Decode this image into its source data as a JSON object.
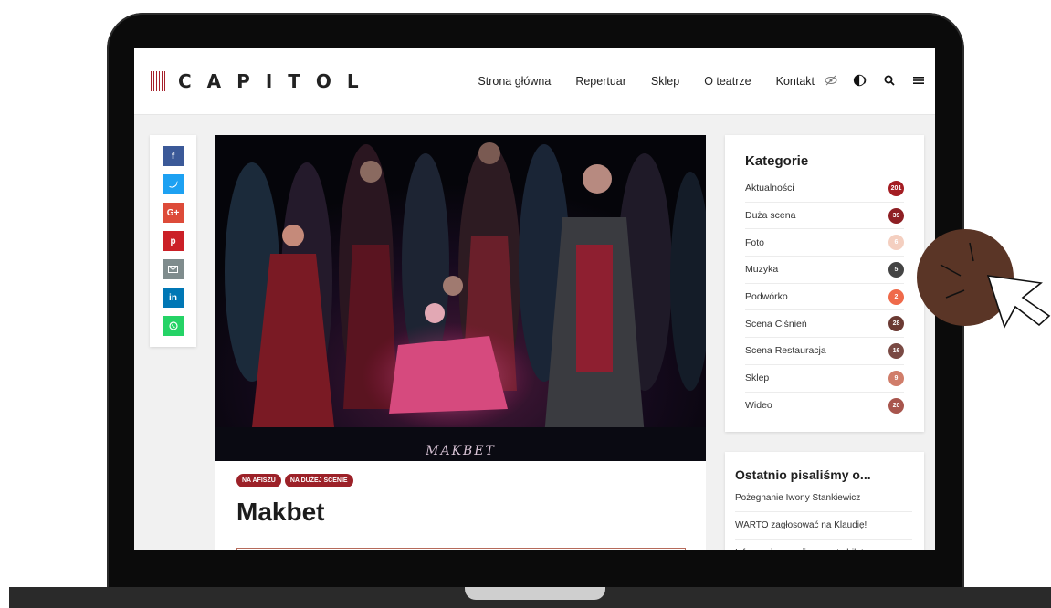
{
  "header": {
    "logo_text": "CAPITOL",
    "nav": [
      "Strona główna",
      "Repertuar",
      "Sklep",
      "O teatrze",
      "Kontakt"
    ],
    "icons": [
      "eye-off-icon",
      "audio-icon",
      "search-icon",
      "menu-icon"
    ]
  },
  "share": [
    {
      "icon": "facebook-icon",
      "glyph": "f",
      "color": "#3b5998"
    },
    {
      "icon": "twitter-icon",
      "glyph": "t",
      "color": "#1da1f2"
    },
    {
      "icon": "google-plus-icon",
      "glyph": "G+",
      "color": "#dd4b39"
    },
    {
      "icon": "pinterest-icon",
      "glyph": "p",
      "color": "#cb2027"
    },
    {
      "icon": "email-icon",
      "glyph": "✉",
      "color": "#7f8c8d"
    },
    {
      "icon": "linkedin-icon",
      "glyph": "in",
      "color": "#0077b5"
    },
    {
      "icon": "whatsapp-icon",
      "glyph": "✆",
      "color": "#25d366"
    }
  ],
  "article": {
    "image_caption": "MAKBET",
    "tags": [
      "NA AFISZU",
      "NA DUŻEJ SCENIE"
    ],
    "title": "Makbet"
  },
  "sidebar": {
    "categories_title": "Kategorie",
    "categories": [
      {
        "label": "Aktualności",
        "count": "201",
        "color": "#a41d23"
      },
      {
        "label": "Duża scena",
        "count": "39",
        "color": "#8e1f24"
      },
      {
        "label": "Foto",
        "count": "6",
        "color": "#f4cfc0"
      },
      {
        "label": "Muzyka",
        "count": "5",
        "color": "#444444"
      },
      {
        "label": "Podwórko",
        "count": "2",
        "color": "#ef6a4a"
      },
      {
        "label": "Scena Ciśnień",
        "count": "28",
        "color": "#6b3a33"
      },
      {
        "label": "Scena Restauracja",
        "count": "16",
        "color": "#7a4a44"
      },
      {
        "label": "Sklep",
        "count": "9",
        "color": "#d07d6a"
      },
      {
        "label": "Wideo",
        "count": "20",
        "color": "#a8554d"
      }
    ],
    "recent_title": "Ostatnio pisaliśmy o...",
    "recent": [
      "Pożegnanie Iwony Stankiewicz",
      "WARTO zagłosować na Klaudię!",
      "Informacja o akcji prezentu bilet"
    ]
  },
  "colors": {
    "accent": "#9c2128",
    "cursor_blob": "#5a3526"
  }
}
